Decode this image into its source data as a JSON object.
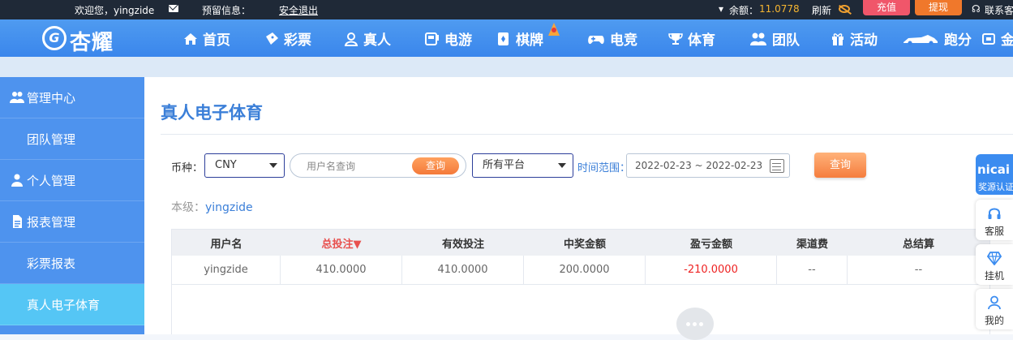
{
  "topbar": {
    "welcome": "欢迎您，yingzide",
    "warning_label": "预留信息：",
    "logout": "安全退出",
    "balance_label": "余额：",
    "balance_value": "11.0778",
    "refresh": "刷新",
    "recharge": "充值",
    "withdraw": "提现",
    "contact": "联系客"
  },
  "nav": {
    "logo_text": "杏耀",
    "items": [
      "首页",
      "彩票",
      "真人",
      "电游",
      "棋牌",
      "电竞",
      "体育",
      "团队",
      "活动",
      "跑分",
      "金"
    ]
  },
  "sidebar": {
    "items": [
      {
        "label": "管理中心",
        "icon": "users-icon"
      },
      {
        "label": "团队管理"
      },
      {
        "label": "个人管理",
        "icon": "user-icon"
      },
      {
        "label": "报表管理",
        "icon": "report-icon"
      },
      {
        "label": "彩票报表"
      },
      {
        "label": "真人电子体育"
      }
    ]
  },
  "main": {
    "title": "真人电子体育",
    "currency_label": "币种：",
    "currency_value": "CNY",
    "username_placeholder": "用户名查询",
    "username_search": "查询",
    "platform_value": "所有平台",
    "time_label": "时间范围：",
    "date_range": "2022-02-23 ~ 2022-02-23",
    "search_button": "查询",
    "level_label": "本级：",
    "level_user": "yingzide"
  },
  "table": {
    "headers": [
      "用户名",
      "总投注▼",
      "有效投注",
      "中奖金额",
      "盈亏金额",
      "渠道费",
      "总结算"
    ],
    "rows": [
      [
        "yingzide",
        "410.0000",
        "410.0000",
        "200.0000",
        "-210.0000",
        "--",
        "--"
      ]
    ]
  },
  "right_panel": {
    "brand": "nicai",
    "brand_sub": "奖源认证",
    "items": [
      "客服",
      "挂机",
      "我的"
    ]
  },
  "colors": {
    "nav_bg": "#3a86ec",
    "sidebar_bg": "#4e93ee",
    "active_item": "#55c6f5",
    "accent_orange": "#f57d3d",
    "negative": "#e22222"
  }
}
